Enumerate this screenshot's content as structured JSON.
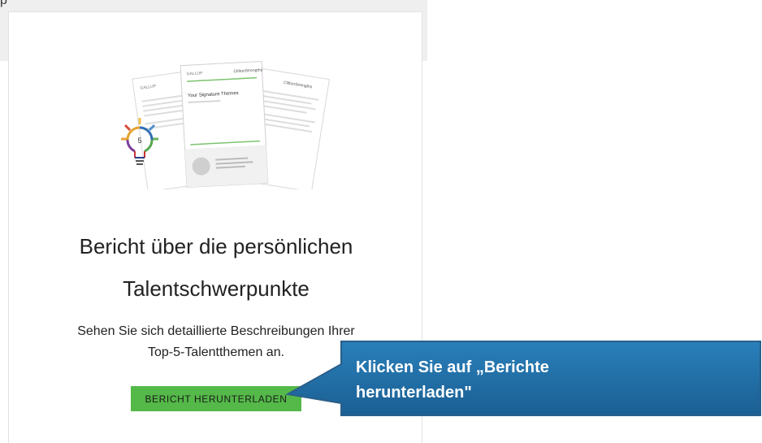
{
  "card": {
    "title_line1": "Bericht über die persönlichen",
    "title_line2": "Talentschwerpunkte",
    "description_line1": "Sehen Sie sich detaillierte Beschreibungen Ihrer",
    "description_line2": "Top-5-Talentthemen an.",
    "download_button_label": "BERICHT HERUNTERLADEN"
  },
  "illustration": {
    "doc_brand_left": "GALLUP",
    "doc_brand_center": "GALLUP",
    "doc_brand_right": "CliftonStrengths",
    "doc_brand_right2": "CliftonStrengths",
    "doc_heading": "Your Signature Themes",
    "bulb_number": "5"
  },
  "callout": {
    "text_line1": "Klicken Sie auf „Berichte",
    "text_line2": "herunterladen\"",
    "fill_color": "#1f6fa8"
  },
  "colors": {
    "button_green": "#54b948",
    "callout_blue": "#1f6fa8"
  }
}
